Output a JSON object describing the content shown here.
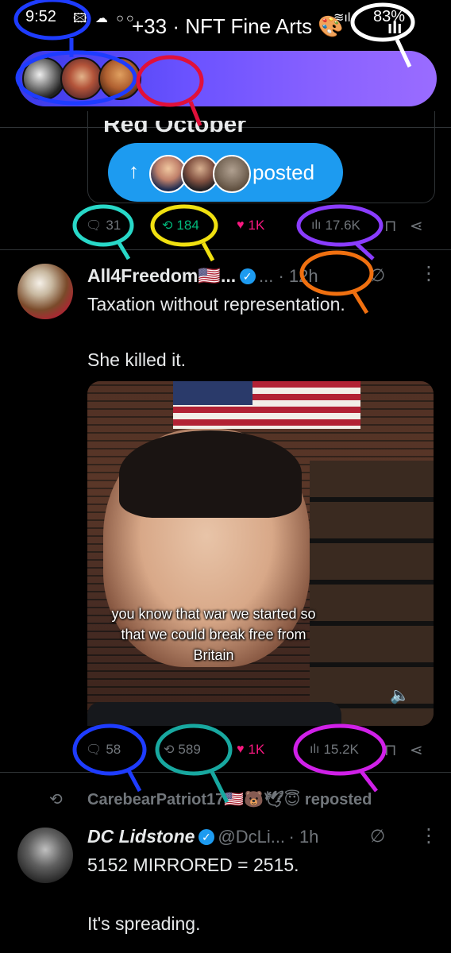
{
  "status_bar": {
    "time": "9:52",
    "left_icons": "🖾 ☁ ○○",
    "wifi": "≋ıl",
    "battery": "83%"
  },
  "community_pill": {
    "label": "+33 · NFT Fine Arts 🎨",
    "more": "ıIı"
  },
  "quoted_card": {
    "title": "Red October"
  },
  "posted_toast": {
    "arrow": "↑",
    "label": "posted"
  },
  "post1_actions": {
    "replies": "31",
    "reposts": "184",
    "likes": "1K",
    "views": "17.6K"
  },
  "post2": {
    "name": "All4Freedom🇺🇸...",
    "meta": "... · 12h",
    "line1": "Taxation without representation.",
    "line2": "She killed it.",
    "video_caption": "you know that war we started so that we could break free from Britain",
    "actions": {
      "replies": "58",
      "reposts": "589",
      "likes": "1K",
      "views": "15.2K"
    }
  },
  "repost_banner": {
    "text": "CarebearPatriot17🇺🇸🐻🕊😇 reposted"
  },
  "post3": {
    "name": "DC Lidstone",
    "handle": "@DcLi...",
    "time": "· 1h",
    "line1": "5152 MIRRORED = 2515.",
    "line2": "It's spreading."
  },
  "annotation_colors": {
    "blue": "#1e3cff",
    "red": "#e0103a",
    "cyan": "#28d8c8",
    "yellow": "#f0e010",
    "purple": "#8a3cff",
    "orange": "#f07010",
    "teal": "#18a8a0",
    "magenta": "#d020e8",
    "white": "#ffffff"
  }
}
